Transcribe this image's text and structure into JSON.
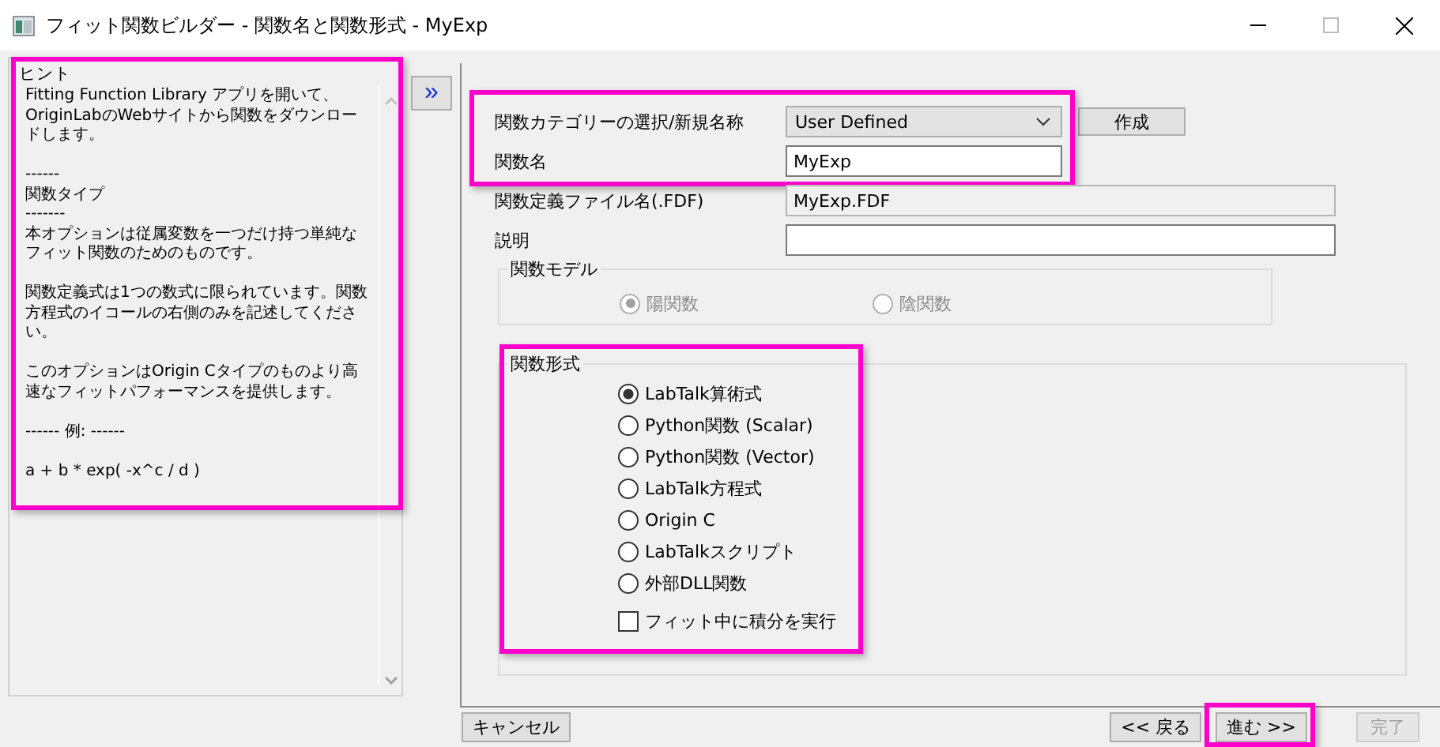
{
  "window": {
    "title": "フィット関数ビルダー - 関数名と関数形式 - MyExp"
  },
  "hint_panel": {
    "title": "ヒント",
    "highlighted": true,
    "paragraphs": [
      "Fitting Function Library アプリを開いて、OriginLabのWebサイトから関数をダウンロードします。",
      "------\n関数タイプ\n-------\n本オプションは従属変数を一つだけ持つ単純なフィット関数のためのものです。",
      "関数定義式は1つの数式に限られています。関数方程式のイコールの右側のみを記述してください。",
      "このオプションはOrigin Cタイプのものより高速なフィットパフォーマンスを提供します。",
      "------ 例: ------",
      "a + b * exp( -x^c / d )"
    ]
  },
  "expand_button": "»",
  "form": {
    "groups": [
      {
        "highlighted": true,
        "fields": [
          {
            "kind": "dropdown",
            "label": "関数カテゴリーの選択/新規名称",
            "value": "User Defined",
            "button": "作成"
          },
          {
            "kind": "input",
            "label": "関数名",
            "value": "MyExp"
          }
        ]
      },
      {
        "highlighted": false,
        "fields": [
          {
            "kind": "readonly",
            "label": "関数定義ファイル名(.FDF)",
            "value": "MyExp.FDF"
          },
          {
            "kind": "wide-input",
            "label": "説明"
          }
        ]
      }
    ]
  },
  "function_model": {
    "title": "関数モデル",
    "disabled": true,
    "options": [
      {
        "label": "陽関数",
        "selected": true
      },
      {
        "label": "陰関数",
        "selected": false
      }
    ]
  },
  "function_form": {
    "title": "関数形式",
    "highlighted": true,
    "options": [
      {
        "label": "LabTalk算術式",
        "selected": true
      },
      {
        "label": "Python関数 (Scalar)",
        "selected": false
      },
      {
        "label": "Python関数 (Vector)",
        "selected": false
      },
      {
        "label": "LabTalk方程式",
        "selected": false
      },
      {
        "label": "Origin C",
        "selected": false
      },
      {
        "label": "LabTalkスクリプト",
        "selected": false
      },
      {
        "label": "外部DLL関数",
        "selected": false
      }
    ],
    "checkbox": {
      "label": "フィット中に積分を実行",
      "checked": false
    }
  },
  "buttons": [
    {
      "label": "キャンセル",
      "disabled": false,
      "highlighted": false
    },
    {
      "label": "<< 戻る",
      "disabled": false,
      "highlighted": false
    },
    {
      "label": "進む >>",
      "disabled": false,
      "highlighted": true
    },
    {
      "label": "完了",
      "disabled": true,
      "highlighted": false
    }
  ]
}
